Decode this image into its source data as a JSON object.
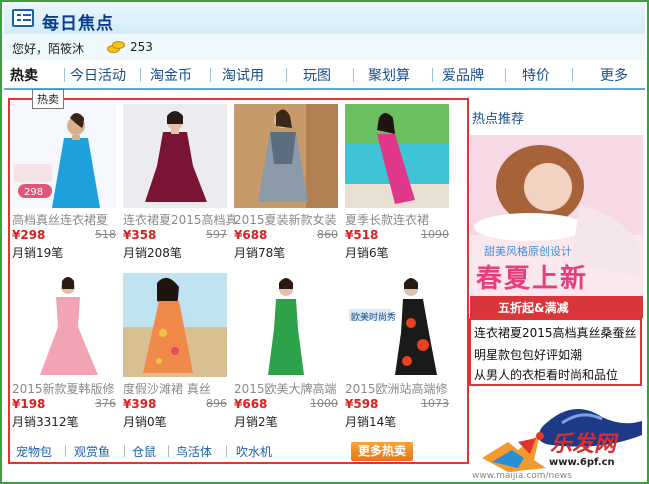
{
  "app": {
    "title": "每日焦点"
  },
  "user": {
    "greeting": "您好，陌筱沐",
    "coins": "253"
  },
  "tabs": [
    {
      "label": "热卖"
    },
    {
      "label": "今日活动"
    },
    {
      "label": "淘金币"
    },
    {
      "label": "淘试用"
    },
    {
      "label": "玩图"
    },
    {
      "label": "聚划算"
    },
    {
      "label": "爱品牌"
    },
    {
      "label": "特价"
    },
    {
      "label": "更多"
    }
  ],
  "tooltip": "热卖",
  "products": [
    {
      "name": "高档真丝连衣裙夏",
      "price": "¥298",
      "old_price": "518",
      "sold": "月销19笔",
      "badge": "298"
    },
    {
      "name": "连衣裙夏2015高档真丝",
      "price": "¥358",
      "old_price": "597",
      "sold": "月销208笔",
      "badge": ""
    },
    {
      "name": "2015夏装新款女装",
      "price": "¥688",
      "old_price": "860",
      "sold": "月销78笔",
      "badge": ""
    },
    {
      "name": "夏季长款连衣裙",
      "price": "¥518",
      "old_price": "1090",
      "sold": "月销6笔",
      "badge": ""
    },
    {
      "name": "2015新款夏韩版修",
      "price": "¥198",
      "old_price": "376",
      "sold": "月销3312笔",
      "badge": ""
    },
    {
      "name": "度假沙滩裙 真丝",
      "price": "¥398",
      "old_price": "896",
      "sold": "月销0笔",
      "badge": ""
    },
    {
      "name": "2015欧美大牌高端",
      "price": "¥668",
      "old_price": "1000",
      "sold": "月销2笔",
      "badge": ""
    },
    {
      "name": "2015欧洲站高端修",
      "price": "¥598",
      "old_price": "1073",
      "sold": "月销14笔",
      "badge": ""
    }
  ],
  "product_overlay": {
    "p7_text": "欧美时尚秀"
  },
  "categories": [
    "宠物包",
    "观赏鱼",
    "仓鼠",
    "鸟活体",
    "吹水机"
  ],
  "more_hot": "更多热卖",
  "sidebar": {
    "title": "热点推荐",
    "banner_sub": "甜美风格原创设计",
    "banner_title": "春夏上新",
    "banner_strip": "五折起&满减",
    "promo_lines": [
      "连衣裙夏2015高档真丝桑蚕丝",
      "明星款包包好评如潮",
      "从男人的衣柜看时尚和品位"
    ]
  },
  "watermark": {
    "brand": "乐发网",
    "url": "www.6pf.cn",
    "url2": "www.maijia.com/news"
  },
  "colors": {
    "price": "#d82020",
    "link": "#1a5fa8",
    "highlight_box": "#e63232",
    "tab_text": "#1a4d8a"
  }
}
